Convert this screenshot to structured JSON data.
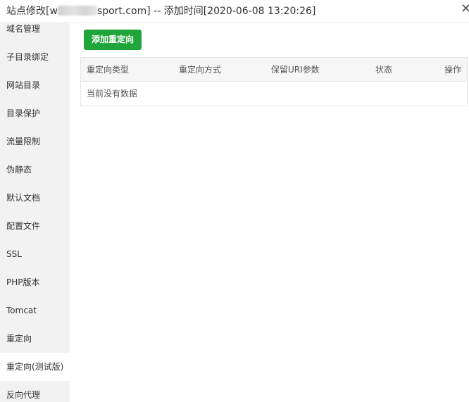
{
  "window": {
    "title_prefix": "站点修改[w",
    "title_suffix": "sport.com] -- 添加时间[2020-06-08 13:20:26]",
    "close_glyph": "✕"
  },
  "sidebar": {
    "items": [
      {
        "label": "域名管理"
      },
      {
        "label": "子目录绑定"
      },
      {
        "label": "网站目录"
      },
      {
        "label": "目录保护"
      },
      {
        "label": "流量限制"
      },
      {
        "label": "伪静态"
      },
      {
        "label": "默认文档"
      },
      {
        "label": "配置文件"
      },
      {
        "label": "SSL"
      },
      {
        "label": "PHP版本"
      },
      {
        "label": "Tomcat"
      },
      {
        "label": "重定向"
      },
      {
        "label": "重定向(测试版)",
        "active": true
      },
      {
        "label": "反向代理"
      }
    ]
  },
  "toolbar": {
    "add_label": "添加重定向"
  },
  "table": {
    "columns": [
      "重定向类型",
      "重定向方式",
      "保留URI参数",
      "状态",
      "操作"
    ],
    "empty_text": "当前没有数据"
  },
  "colors": {
    "accent": "#20a53a",
    "sidebar_bg": "#f2f2f2",
    "header_bg": "#f6f6f6"
  }
}
